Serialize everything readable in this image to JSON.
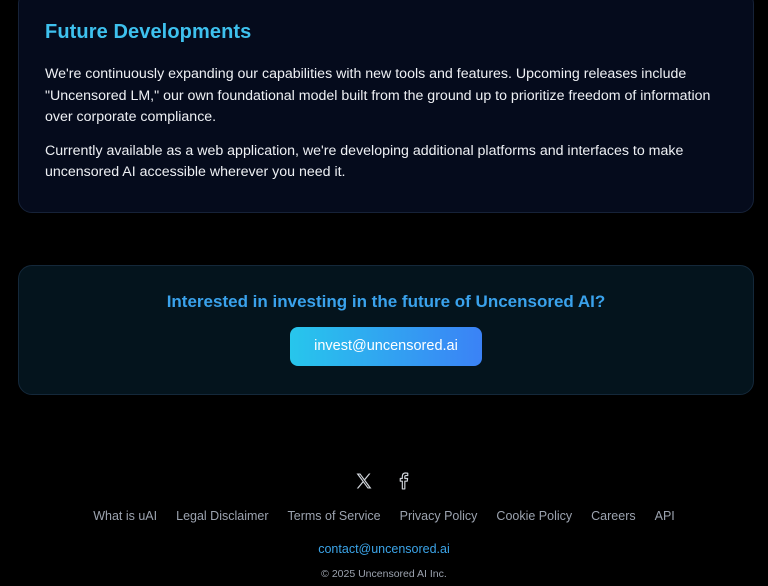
{
  "future": {
    "title": "Future Developments",
    "paragraph_1": "We're continuously expanding our capabilities with new tools and features. Upcoming releases include \"Uncensored LM,\" our own foundational model built from the ground up to prioritize freedom of information over corporate compliance.",
    "paragraph_2": "Currently available as a web application, we're developing additional platforms and interfaces to make uncensored AI accessible wherever you need it."
  },
  "invest": {
    "heading": "Interested in investing in the future of Uncensored AI?",
    "email_button": "invest@uncensored.ai"
  },
  "socials": {
    "icons": [
      "x-icon",
      "facebook-icon"
    ]
  },
  "footer": {
    "links": [
      "What is uAI",
      "Legal Disclaimer",
      "Terms of Service",
      "Privacy Policy",
      "Cookie Policy",
      "Careers",
      "API"
    ],
    "contact_email": "contact@uncensored.ai",
    "copyright": "© 2025 Uncensored AI Inc."
  },
  "colors": {
    "accent_cyan": "#3ec1ee",
    "accent_blue": "#3aa2ec",
    "button_gradient_start": "#27c6ec",
    "button_gradient_end": "#3b82f6",
    "background": "#000000"
  }
}
